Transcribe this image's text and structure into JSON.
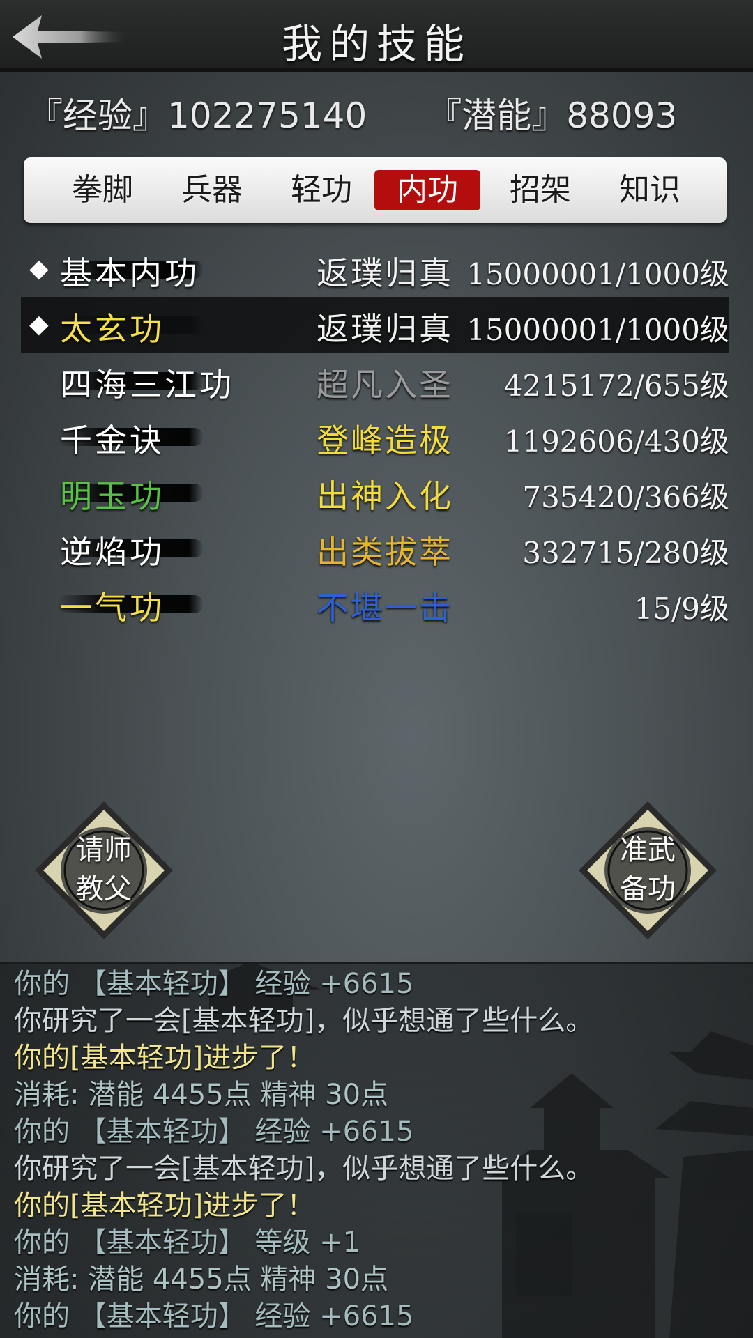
{
  "header": {
    "title": "我的技能"
  },
  "stats": {
    "exp_label": "『经验』102275140",
    "potential_label": "『潜能』88093"
  },
  "tabs": [
    {
      "label": "拳脚",
      "active": false
    },
    {
      "label": "兵器",
      "active": false
    },
    {
      "label": "轻功",
      "active": false
    },
    {
      "label": "内功",
      "active": true
    },
    {
      "label": "招架",
      "active": false
    },
    {
      "label": "知识",
      "active": false
    }
  ],
  "skills": [
    {
      "name": "基本内功",
      "tier": "返璞归真",
      "level": "15000001/1000级",
      "name_color": "#ffffff",
      "tier_color": "#f2f2f2",
      "marked": true,
      "selected": false
    },
    {
      "name": "太玄功",
      "tier": "返璞归真",
      "level": "15000001/1000级",
      "name_color": "#f5e04a",
      "tier_color": "#f2f2f2",
      "marked": true,
      "selected": true
    },
    {
      "name": "四海三江功",
      "tier": "超凡入圣",
      "level": "4215172/655级",
      "name_color": "#ffffff",
      "tier_color": "#9b9b9b",
      "marked": false,
      "selected": false
    },
    {
      "name": "千金诀",
      "tier": "登峰造极",
      "level": "1192606/430级",
      "name_color": "#ffffff",
      "tier_color": "#f1dc3a",
      "marked": false,
      "selected": false
    },
    {
      "name": "明玉功",
      "tier": "出神入化",
      "level": "735420/366级",
      "name_color": "#57c243",
      "tier_color": "#f1dc3a",
      "marked": false,
      "selected": false
    },
    {
      "name": "逆焰功",
      "tier": "出类拔萃",
      "level": "332715/280级",
      "name_color": "#ffffff",
      "tier_color": "#e6b52e",
      "marked": false,
      "selected": false
    },
    {
      "name": "一气功",
      "tier": "不堪一击",
      "level": "15/9级",
      "name_color": "#f5e04a",
      "tier_color": "#2f5fd0",
      "marked": false,
      "selected": false
    }
  ],
  "buttons": {
    "teacher": {
      "line1": "请师",
      "line2": "教父"
    },
    "prepare": {
      "line1": "准武",
      "line2": "备功"
    }
  },
  "log": [
    {
      "text": "你的 【基本轻功】 经验 +6615",
      "type": "info"
    },
    {
      "text": "你研究了一会[基本轻功]，似乎想通了些什么。",
      "type": "study"
    },
    {
      "text": "你的[基本轻功]进步了！",
      "type": "progress"
    },
    {
      "text": "消耗: 潜能 4455点  精神 30点",
      "type": "cost"
    },
    {
      "text": "你的 【基本轻功】 经验 +6615",
      "type": "info"
    },
    {
      "text": "你研究了一会[基本轻功]，似乎想通了些什么。",
      "type": "study"
    },
    {
      "text": "你的[基本轻功]进步了！",
      "type": "progress"
    },
    {
      "text": "你的 【基本轻功】 等级 +1",
      "type": "info"
    },
    {
      "text": "消耗: 潜能 4455点  精神 30点",
      "type": "cost"
    },
    {
      "text": "你的 【基本轻功】 经验 +6615",
      "type": "info"
    }
  ],
  "icons": {
    "back": "back-arrow-icon",
    "diamond": "diamond-bullet-icon"
  }
}
